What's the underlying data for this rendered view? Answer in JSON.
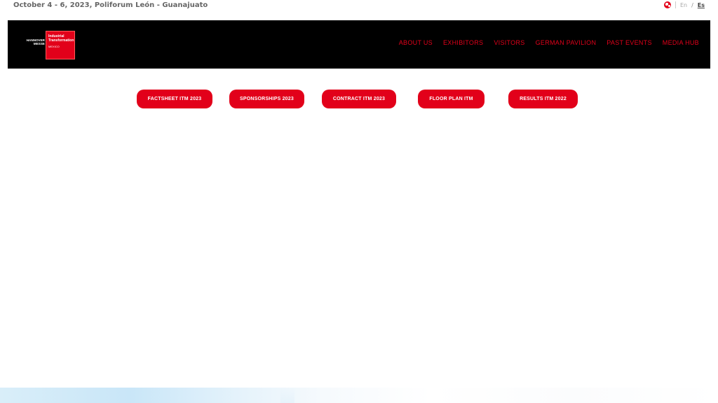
{
  "topbar": {
    "event_date": "October 4 - 6, 2023, Poliforum León - Guanajuato",
    "lang_en": "En",
    "lang_separator": "/",
    "lang_es": "Es"
  },
  "logo": {
    "hm_line1": "HANNOVER",
    "hm_line2": "MESSE",
    "box_line1": "Industrial",
    "box_line2": "Transformation",
    "box_line3": "MEXICO"
  },
  "nav": {
    "items": [
      {
        "label": "ABOUT US"
      },
      {
        "label": "EXHIBITORS"
      },
      {
        "label": "VISITORS"
      },
      {
        "label": "GERMAN PAVILION"
      },
      {
        "label": "PAST EVENTS"
      },
      {
        "label": "MEDIA HUB"
      }
    ]
  },
  "buttons": [
    {
      "label": "FACTSHEET ITM 2023"
    },
    {
      "label": "SPONSORSHIPS 2023"
    },
    {
      "label": "CONTRACT ITM 2023"
    },
    {
      "label": "FLOOR PLAN ITM"
    },
    {
      "label": "RESULTS ITM 2022"
    }
  ],
  "colors": {
    "accent": "#e2001a",
    "header_bg": "#000000",
    "page_bg": "#ffffff"
  },
  "icons": {
    "language": "globe-icon"
  }
}
